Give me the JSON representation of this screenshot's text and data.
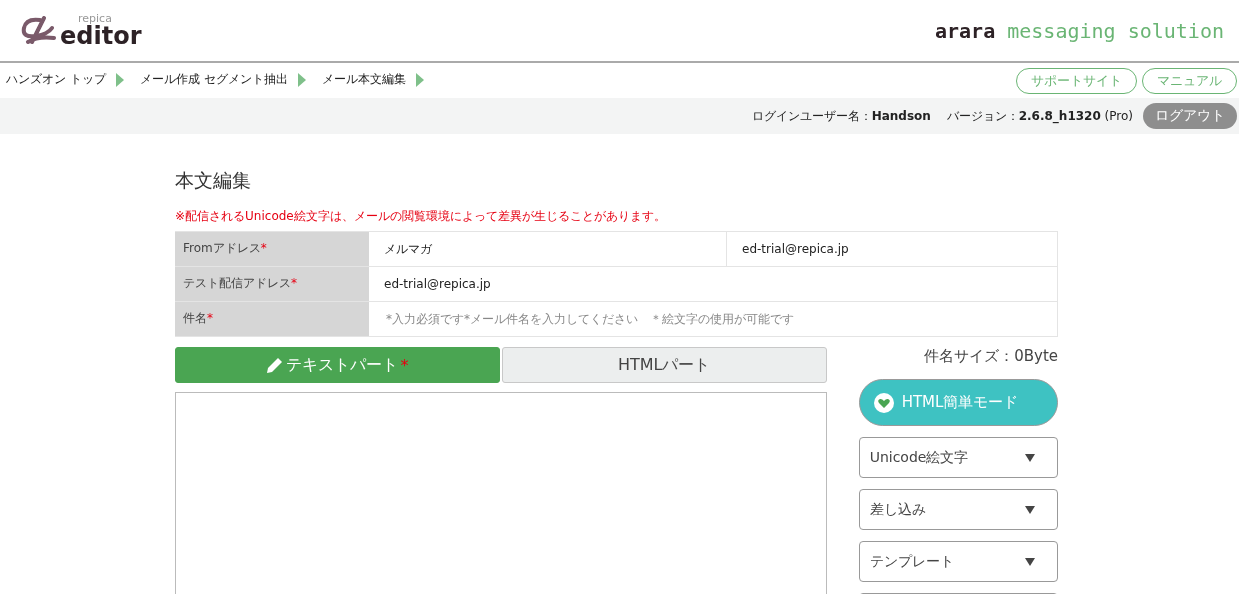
{
  "header": {
    "logo_small": "repica",
    "logo_large": "editor",
    "brand_bold": "arara",
    "brand_tagline": "messaging solution"
  },
  "breadcrumbs": [
    "ハンズオン トップ",
    "メール作成 セグメント抽出",
    "メール本文編集"
  ],
  "header_links": [
    "サポートサイト",
    "マニュアル"
  ],
  "user_bar": {
    "user_label": "ログインユーザー名：",
    "user_name": "Handson",
    "version_label": "バージョン：",
    "version": "2.6.8_h1320",
    "edition": "(Pro)",
    "logout": "ログアウト"
  },
  "page_title": "本文編集",
  "notice": "※配信されるUnicode絵文字は、メールの閲覧環境によって差異が生じることがあります。",
  "form_rows": [
    {
      "label": "Fromアドレス",
      "required_mark": "*",
      "kind": "split",
      "value": "メルマガ",
      "value_2": "ed-trial@repica.jp"
    },
    {
      "label": "テスト配信アドレス",
      "required_mark": "*",
      "kind": "text",
      "value": "ed-trial@repica.jp"
    },
    {
      "label": "件名",
      "required_mark": "*",
      "kind": "input",
      "placeholder": "*入力必須です*メール件名を入力してください　＊絵文字の使用が可能です"
    }
  ],
  "tabs": [
    {
      "label": "テキストパート",
      "required_mark": "*",
      "selected": true
    },
    {
      "label": "HTMLパート",
      "selected": false
    }
  ],
  "subject_size": "件名サイズ：0Byte",
  "easy_mode_button": "HTML簡単モード",
  "dropdowns": [
    "Unicode絵文字",
    "差し込み",
    "テンプレート"
  ]
}
